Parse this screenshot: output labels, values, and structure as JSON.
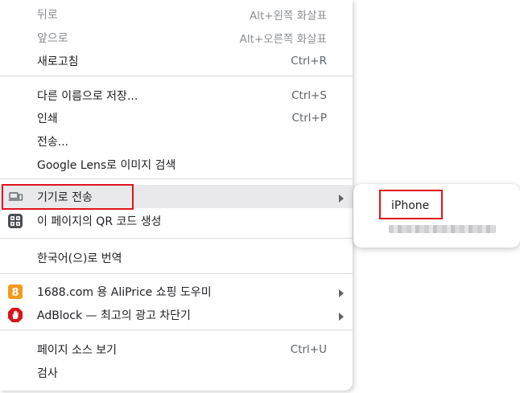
{
  "context_menu": {
    "items": {
      "back": {
        "label": "뒤로",
        "shortcut": "Alt+왼쪽 화살표"
      },
      "forward": {
        "label": "앞으로",
        "shortcut": "Alt+오른쪽 화살표"
      },
      "reload": {
        "label": "새로고침",
        "shortcut": "Ctrl+R"
      },
      "save_as": {
        "label": "다른 이름으로 저장...",
        "shortcut": "Ctrl+S"
      },
      "print": {
        "label": "인쇄",
        "shortcut": "Ctrl+P"
      },
      "cast": {
        "label": "전송..."
      },
      "google_lens": {
        "label": "Google Lens로 이미지 검색"
      },
      "send_to_devices": {
        "label": "기기로 전송",
        "icon": "devices-icon"
      },
      "qr_code": {
        "label": "이 페이지의 QR 코드 생성",
        "icon": "qr-code-icon"
      },
      "translate": {
        "label": "한국어(으)로 번역"
      },
      "aliprice": {
        "label": "1688.com 용 AliPrice 쇼핑 도우미",
        "icon": "aliprice-icon",
        "icon_text": "8"
      },
      "adblock": {
        "label": "AdBlock — 최고의 광고 차단기",
        "icon": "adblock-icon"
      },
      "view_source": {
        "label": "페이지 소스 보기",
        "shortcut": "Ctrl+U"
      },
      "inspect": {
        "label": "검사"
      }
    }
  },
  "devices_submenu": {
    "device_name": "iPhone"
  },
  "colors": {
    "highlight_border": "#e0141b",
    "aliprice_orange": "#f39a1e",
    "adblock_red": "#d8161b"
  }
}
